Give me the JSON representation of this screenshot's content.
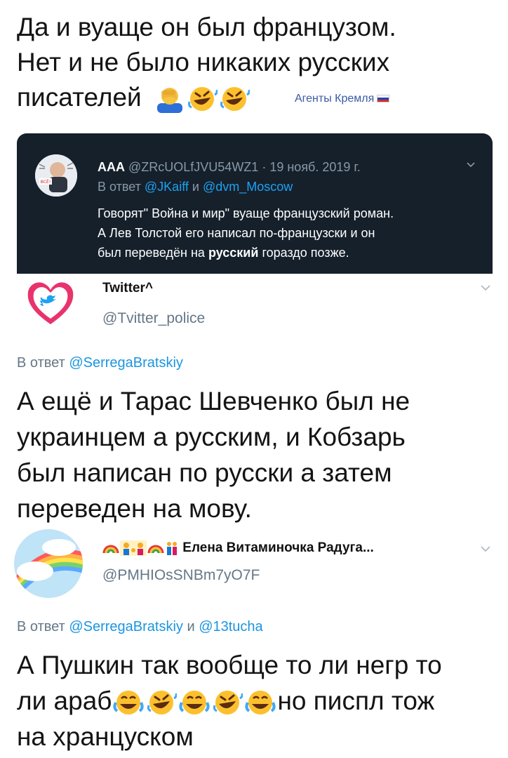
{
  "top_post": {
    "lines": [
      "Да и вуаще он был французом.",
      "Нет и не было никаких русских",
      "писателей"
    ],
    "emojis": [
      "facepalm-emoji",
      "rofl-emoji",
      "rofl-emoji"
    ]
  },
  "watermark": {
    "label": "Агенты Кремля",
    "flag": "russian-flag-icon"
  },
  "quoted_tweet": {
    "display_name": "AAA",
    "handle": "@ZRcUOLfJVU54WZ1",
    "date": "· 19 нояб. 2019 г.",
    "reply_prefix": "В ответ",
    "reply_mentions": [
      "@JKaiff",
      "@dvm_Moscow"
    ],
    "reply_joiner": "и",
    "body_lines": [
      "Говорят\" Война и мир\" вуаще французский роман.",
      "А Лев Толстой его написал по-французски и он",
      "был переведён на"
    ],
    "body_bold": "русский",
    "body_tail": "гораздо позже.",
    "avatar_badge": "ВСЁ!"
  },
  "tweet1": {
    "display_name": "Twitter^",
    "handle": "@Tvitter_police",
    "reply_prefix": "В ответ",
    "reply_mention": "@SerregaBratskiy",
    "lines": [
      "А ещё и Тарас Шевченко был не",
      "украинцем а русским, и Кобзарь",
      "был написан по русски а затем",
      "переведен на мову."
    ]
  },
  "tweet2": {
    "display_name": "Елена Витаминочка Радуга...",
    "handle": "@PMHIOsSNBm7yO7F",
    "reply_prefix": "В ответ",
    "reply_mentions": [
      "@SerregaBratskiy",
      "@13tucha"
    ],
    "reply_joiner": "и",
    "line1": "А Пушкин так вообще то ли негр то",
    "line2_start": "ли араб",
    "line2_end": "но писпл тож",
    "line3": "на хранцуском",
    "name_emojis": [
      "rainbow-emoji",
      "family-emoji",
      "rainbow-emoji",
      "couple-emoji"
    ],
    "text_emojis": [
      "joy-emoji",
      "rofl-emoji",
      "joy-emoji",
      "rofl-emoji",
      "joy-emoji"
    ]
  }
}
